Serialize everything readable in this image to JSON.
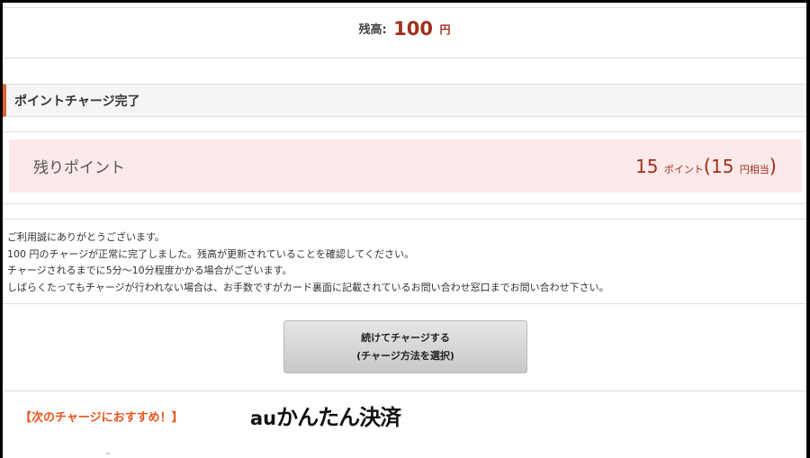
{
  "balance": {
    "label": "残高:",
    "amount": "100",
    "unit": "円"
  },
  "section": {
    "title": "ポイントチャージ完了"
  },
  "points": {
    "label": "残りポイント",
    "value": "15",
    "value_unit": "ポイント",
    "paren_open": "(",
    "yen_value": "15",
    "yen_unit": "円相当",
    "paren_close": ")"
  },
  "message": {
    "lines": [
      "ご利用誠にありがとうございます。",
      "100 円のチャージが正常に完了しました。残高が更新されていることを確認してください。",
      "チャージされるまでに5分～10分程度かかる場合がございます。",
      "しばらくたってもチャージが行われない場合は、お手数ですがカード裏面に記載されているお問い合わせ窓口までお問い合わせ下さい。"
    ]
  },
  "button": {
    "line1": "続けてチャージする",
    "line2": "(チャージ方法を選択)"
  },
  "recommend": {
    "label": "【次のチャージにおすすめ！】"
  },
  "logo": {
    "prefix": "au",
    "text": "かんたん決済"
  },
  "colors": {
    "accent": "#a0301c",
    "orange": "#e8531a",
    "pink_bg": "#fde9ea",
    "bar": "#d9662f"
  }
}
